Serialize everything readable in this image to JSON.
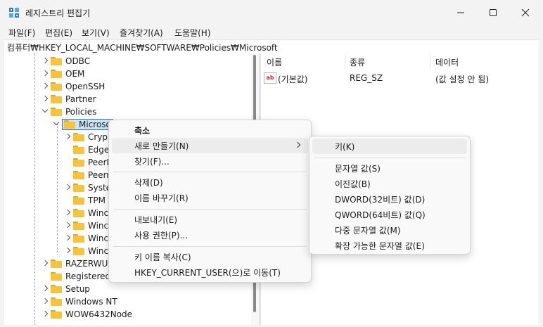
{
  "window": {
    "title": "레지스트리 편집기",
    "min_glyph": "—",
    "max_glyph": "☐",
    "close_glyph": "✕"
  },
  "menu": [
    "파일(F)",
    "편집(E)",
    "보기(V)",
    "즐겨찾기(A)",
    "도움말(H)"
  ],
  "address": "컴퓨터₩HKEY_LOCAL_MACHINE₩SOFTWARE₩Policies₩Microsoft",
  "tree": {
    "top_nodes": [
      "ODBC",
      "OEM",
      "OpenSSH",
      "Partner",
      "Policies"
    ],
    "selected": "Microso",
    "children": [
      "Cryp",
      "Edge",
      "PeerD",
      "Peerr",
      "Syste",
      "TPM",
      "Winc",
      "Winc",
      "Winc",
      "Winc"
    ],
    "bottom_nodes": [
      "RAZERWUD",
      "RegisteredA",
      "Setup",
      "Windows NT",
      "WOW6432Node"
    ]
  },
  "list": {
    "headers": [
      "이름",
      "종류",
      "데이터"
    ],
    "rows": [
      {
        "name": "(기본값)",
        "type": "REG_SZ",
        "data": "(값 설정 안 됨)",
        "icon_text": "ab"
      }
    ]
  },
  "context_menu": [
    "축소",
    "새로 만들기(N)",
    "찾기(F)...",
    "삭제(D)",
    "이름 바꾸기(R)",
    "내보내기(E)",
    "사용 권한(P)...",
    "키 이름 복사(C)",
    "HKEY_CURRENT_USER(으)로 이동(T)"
  ],
  "submenu": [
    "키(K)",
    "문자열 값(S)",
    "이진값(B)",
    "DWORD(32비트) 값(D)",
    "QWORD(64비트) 값(Q)",
    "다중 문자열 값(M)",
    "확장 가능한 문자열 값(E)"
  ],
  "colors": {
    "accent": "#2c6fc9",
    "folder": "#f5c43c",
    "selection_bg": "#cce4f7"
  }
}
